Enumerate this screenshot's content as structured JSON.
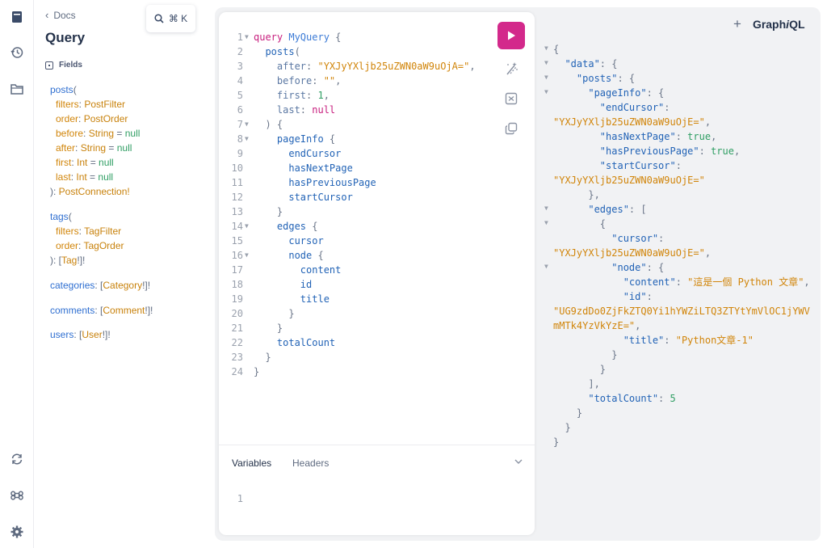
{
  "rail": {
    "items": [
      "docs-icon",
      "history-icon",
      "explorer-icon",
      "refetch-icon",
      "shortcut-icon",
      "settings-icon"
    ]
  },
  "docs": {
    "back_label": "Docs",
    "title": "Query",
    "fields_heading": "Fields"
  },
  "search": {
    "icon": "search-icon",
    "shortcut": "⌘ K"
  },
  "editor": {
    "lines": [
      {
        "n": "1",
        "fold": true,
        "html": [
          [
            "kw",
            "query "
          ],
          [
            "opname",
            "MyQuery"
          ],
          [
            "punc",
            " {"
          ]
        ]
      },
      {
        "n": "2",
        "fold": false,
        "html": [
          [
            "field",
            "  posts"
          ],
          [
            "punc",
            "("
          ]
        ]
      },
      {
        "n": "3",
        "fold": false,
        "html": [
          [
            "argn",
            "    after"
          ],
          [
            "punc",
            ": "
          ],
          [
            "str",
            "\"YXJyYXljb25uZWN0aW9uOjA=\""
          ],
          [
            "punc",
            ","
          ]
        ]
      },
      {
        "n": "4",
        "fold": false,
        "html": [
          [
            "argn",
            "    before"
          ],
          [
            "punc",
            ": "
          ],
          [
            "str",
            "\"\""
          ],
          [
            "punc",
            ","
          ]
        ]
      },
      {
        "n": "5",
        "fold": false,
        "html": [
          [
            "argn",
            "    first"
          ],
          [
            "punc",
            ": "
          ],
          [
            "num",
            "1"
          ],
          [
            "punc",
            ","
          ]
        ]
      },
      {
        "n": "6",
        "fold": false,
        "html": [
          [
            "argn",
            "    last"
          ],
          [
            "punc",
            ": "
          ],
          [
            "kw",
            "null"
          ]
        ]
      },
      {
        "n": "7",
        "fold": true,
        "html": [
          [
            "punc",
            "  ) {"
          ]
        ]
      },
      {
        "n": "8",
        "fold": true,
        "html": [
          [
            "field",
            "    pageInfo"
          ],
          [
            "punc",
            " {"
          ]
        ]
      },
      {
        "n": "9",
        "fold": false,
        "html": [
          [
            "field",
            "      endCursor"
          ]
        ]
      },
      {
        "n": "10",
        "fold": false,
        "html": [
          [
            "field",
            "      hasNextPage"
          ]
        ]
      },
      {
        "n": "11",
        "fold": false,
        "html": [
          [
            "field",
            "      hasPreviousPage"
          ]
        ]
      },
      {
        "n": "12",
        "fold": false,
        "html": [
          [
            "field",
            "      startCursor"
          ]
        ]
      },
      {
        "n": "13",
        "fold": false,
        "html": [
          [
            "punc",
            "    }"
          ]
        ]
      },
      {
        "n": "14",
        "fold": true,
        "html": [
          [
            "field",
            "    edges"
          ],
          [
            "punc",
            " {"
          ]
        ]
      },
      {
        "n": "15",
        "fold": false,
        "html": [
          [
            "field",
            "      cursor"
          ]
        ]
      },
      {
        "n": "16",
        "fold": true,
        "html": [
          [
            "field",
            "      node"
          ],
          [
            "punc",
            " {"
          ]
        ]
      },
      {
        "n": "17",
        "fold": false,
        "html": [
          [
            "field",
            "        content"
          ]
        ]
      },
      {
        "n": "18",
        "fold": false,
        "html": [
          [
            "field",
            "        id"
          ]
        ]
      },
      {
        "n": "19",
        "fold": false,
        "html": [
          [
            "field",
            "        title"
          ]
        ]
      },
      {
        "n": "20",
        "fold": false,
        "html": [
          [
            "punc",
            "      }"
          ]
        ]
      },
      {
        "n": "21",
        "fold": false,
        "html": [
          [
            "punc",
            "    }"
          ]
        ]
      },
      {
        "n": "22",
        "fold": false,
        "html": [
          [
            "field",
            "    totalCount"
          ]
        ]
      },
      {
        "n": "23",
        "fold": false,
        "html": [
          [
            "punc",
            "  }"
          ]
        ]
      },
      {
        "n": "24",
        "fold": false,
        "html": [
          [
            "punc",
            "}"
          ]
        ]
      }
    ],
    "variables_tab": "Variables",
    "headers_tab": "Headers",
    "variables_line": "1"
  },
  "result": {
    "plus_label": "+",
    "logo_pre": "Graph",
    "logo_i": "i",
    "logo_post": "QL",
    "lines": [
      {
        "fold": true,
        "html": [
          [
            "rpunc",
            "{"
          ]
        ]
      },
      {
        "fold": true,
        "html": [
          [
            "rkey",
            "  \"data\""
          ],
          [
            "rpunc",
            ": {"
          ]
        ]
      },
      {
        "fold": true,
        "html": [
          [
            "rkey",
            "    \"posts\""
          ],
          [
            "rpunc",
            ": {"
          ]
        ]
      },
      {
        "fold": true,
        "html": [
          [
            "rkey",
            "      \"pageInfo\""
          ],
          [
            "rpunc",
            ": {"
          ]
        ]
      },
      {
        "fold": false,
        "html": [
          [
            "rkey",
            "        \"endCursor\""
          ],
          [
            "rpunc",
            ":"
          ]
        ]
      },
      {
        "fold": false,
        "html": [
          [
            "rstr",
            "\"YXJyYXljb25uZWN0aW9uOjE=\""
          ],
          [
            "rpunc",
            ","
          ]
        ]
      },
      {
        "fold": false,
        "html": [
          [
            "rkey",
            "        \"hasNextPage\""
          ],
          [
            "rpunc",
            ": "
          ],
          [
            "rbool",
            "true"
          ],
          [
            "rpunc",
            ","
          ]
        ]
      },
      {
        "fold": false,
        "html": [
          [
            "rkey",
            "        \"hasPreviousPage\""
          ],
          [
            "rpunc",
            ": "
          ],
          [
            "rbool",
            "true"
          ],
          [
            "rpunc",
            ","
          ]
        ]
      },
      {
        "fold": false,
        "html": [
          [
            "rkey",
            "        \"startCursor\""
          ],
          [
            "rpunc",
            ":"
          ]
        ]
      },
      {
        "fold": false,
        "html": [
          [
            "rstr",
            "\"YXJyYXljb25uZWN0aW9uOjE=\""
          ]
        ]
      },
      {
        "fold": false,
        "html": [
          [
            "rpunc",
            "      },"
          ]
        ]
      },
      {
        "fold": true,
        "html": [
          [
            "rkey",
            "      \"edges\""
          ],
          [
            "rpunc",
            ": ["
          ]
        ]
      },
      {
        "fold": true,
        "html": [
          [
            "rpunc",
            "        {"
          ]
        ]
      },
      {
        "fold": false,
        "html": [
          [
            "rkey",
            "          \"cursor\""
          ],
          [
            "rpunc",
            ":"
          ]
        ]
      },
      {
        "fold": false,
        "html": [
          [
            "rstr",
            "\"YXJyYXljb25uZWN0aW9uOjE=\""
          ],
          [
            "rpunc",
            ","
          ]
        ]
      },
      {
        "fold": true,
        "html": [
          [
            "rkey",
            "          \"node\""
          ],
          [
            "rpunc",
            ": {"
          ]
        ]
      },
      {
        "fold": false,
        "html": [
          [
            "rkey",
            "            \"content\""
          ],
          [
            "rpunc",
            ": "
          ],
          [
            "rstr",
            "\"這是一個 Python 文章\""
          ],
          [
            "rpunc",
            ","
          ]
        ]
      },
      {
        "fold": false,
        "html": [
          [
            "rkey",
            "            \"id\""
          ],
          [
            "rpunc",
            ":"
          ]
        ]
      },
      {
        "fold": false,
        "html": [
          [
            "rstr",
            "\"UG9zdDo0ZjFkZTQ0Yi1hYWZiLTQ3ZTYtYmVlOC1jYWV"
          ]
        ]
      },
      {
        "fold": false,
        "html": [
          [
            "rstr",
            "mMTk4YzVkYzE=\""
          ],
          [
            "rpunc",
            ","
          ]
        ]
      },
      {
        "fold": false,
        "html": [
          [
            "rkey",
            "            \"title\""
          ],
          [
            "rpunc",
            ": "
          ],
          [
            "rstr",
            "\"Python文章-1\""
          ]
        ]
      },
      {
        "fold": false,
        "html": [
          [
            "rpunc",
            "          }"
          ]
        ]
      },
      {
        "fold": false,
        "html": [
          [
            "rpunc",
            "        }"
          ]
        ]
      },
      {
        "fold": false,
        "html": [
          [
            "rpunc",
            "      ],"
          ]
        ]
      },
      {
        "fold": false,
        "html": [
          [
            "rkey",
            "      \"totalCount\""
          ],
          [
            "rpunc",
            ": "
          ],
          [
            "rnum",
            "5"
          ]
        ]
      },
      {
        "fold": false,
        "html": [
          [
            "rpunc",
            "    }"
          ]
        ]
      },
      {
        "fold": false,
        "html": [
          [
            "rpunc",
            "  }"
          ]
        ]
      },
      {
        "fold": false,
        "html": [
          [
            "rpunc",
            "}"
          ]
        ]
      }
    ]
  },
  "colors": {
    "run_button": "#d3298b",
    "keyword": "#c8207f",
    "field": "#2263b6",
    "string": "#d1850a",
    "number": "#2f9e63"
  }
}
